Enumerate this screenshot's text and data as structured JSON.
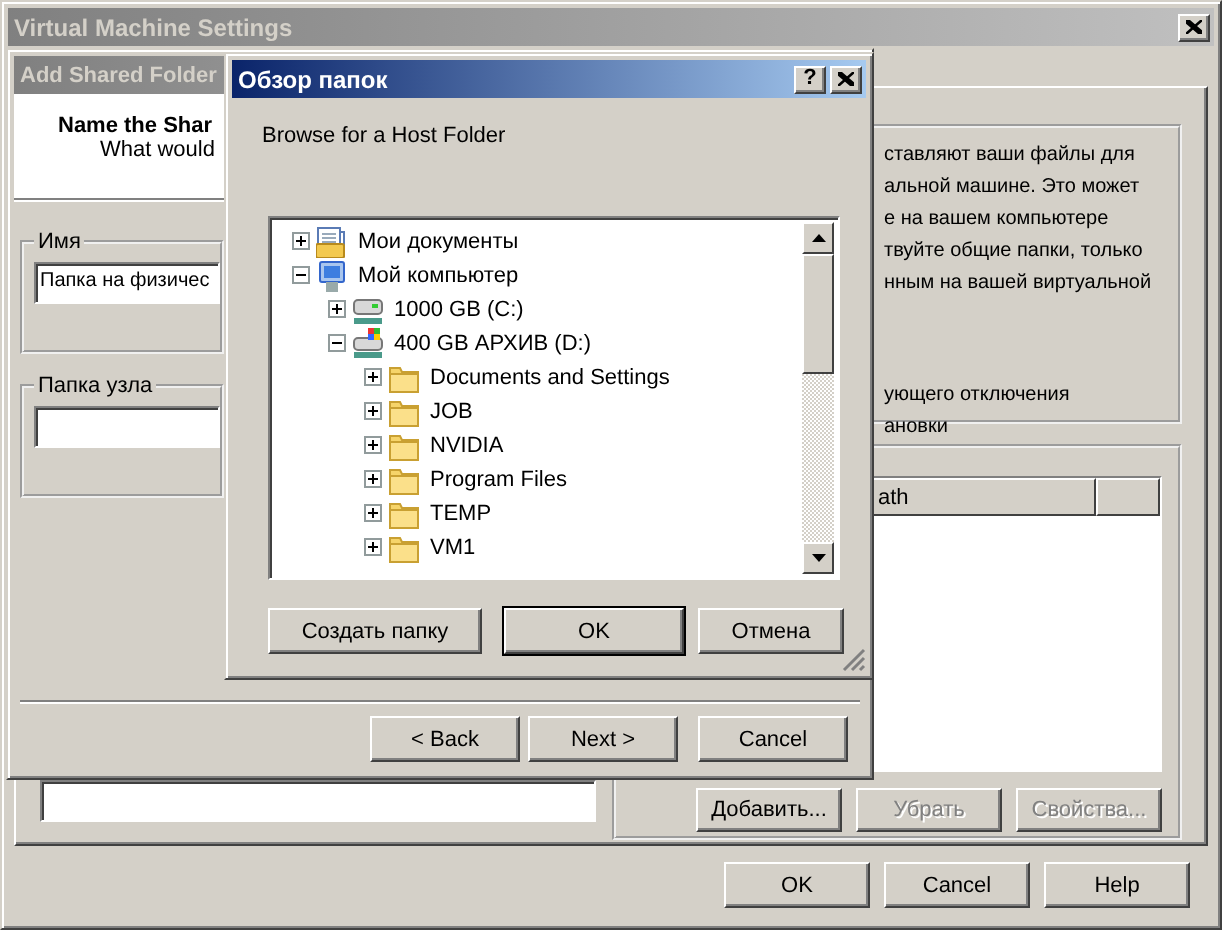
{
  "settings_window": {
    "title": "Virtual Machine Settings",
    "active": false,
    "info_lines": [
      "ставляют ваши файлы для",
      "альной машине. Это может",
      "е на вашем компьютере",
      "твуйте общие папки, только",
      "нным на вашей виртуальной"
    ],
    "option_lines": [
      "ующего отключения",
      "ановки"
    ],
    "table": {
      "columns": [
        "ath"
      ]
    },
    "folder_buttons": [
      {
        "label": "Добавить...",
        "disabled": false
      },
      {
        "label": "Убрать",
        "disabled": true
      },
      {
        "label": "Свойства...",
        "disabled": true
      }
    ],
    "buttons": [
      "OK",
      "Cancel",
      "Help"
    ]
  },
  "wizard": {
    "title": "Add Shared Folder",
    "active": false,
    "heading": "Name the Shar",
    "subheading": "What would",
    "groups": [
      {
        "label": "Имя",
        "value": "Папка на физичес"
      },
      {
        "label": "Папка узла"
      }
    ],
    "buttons": [
      "< Back",
      "Next >",
      "Cancel"
    ]
  },
  "browse_dialog": {
    "title": "Обзор папок",
    "active": true,
    "help_button": "?",
    "prompt": "Browse for a Host Folder",
    "tree": [
      {
        "label": "Мои документы",
        "kind": "documents",
        "expanded": false
      },
      {
        "label": "Мой компьютер",
        "kind": "computer",
        "expanded": true,
        "children": [
          {
            "label": "1000 GB (C:)",
            "kind": "drive",
            "expanded": false
          },
          {
            "label": "400 GB АРХИВ (D:)",
            "kind": "system-drive",
            "expanded": true,
            "children": [
              {
                "label": "Documents and Settings",
                "kind": "folder",
                "expanded": false
              },
              {
                "label": "JOB",
                "kind": "folder",
                "expanded": false
              },
              {
                "label": "NVIDIA",
                "kind": "folder",
                "expanded": false
              },
              {
                "label": "Program Files",
                "kind": "folder",
                "expanded": false
              },
              {
                "label": "TEMP",
                "kind": "folder",
                "expanded": false
              },
              {
                "label": "VM1",
                "kind": "folder",
                "expanded": false
              }
            ]
          }
        ]
      }
    ],
    "buttons": [
      {
        "label": "Создать папку",
        "default": false
      },
      {
        "label": "OK",
        "default": true
      },
      {
        "label": "Отмена",
        "default": false
      }
    ]
  }
}
